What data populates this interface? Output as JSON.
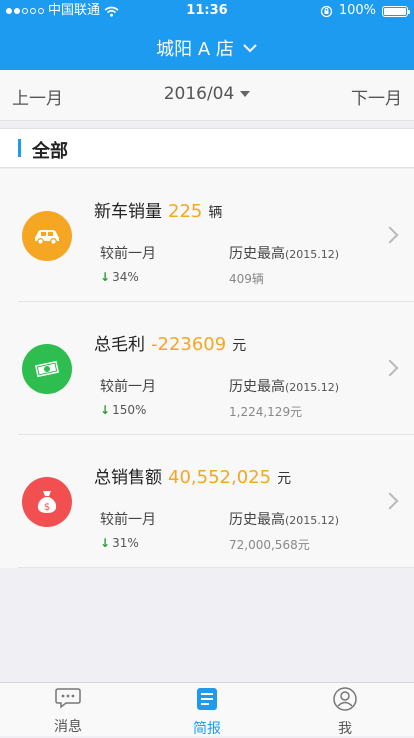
{
  "status": {
    "carrier": "中国联通",
    "time": "11:36",
    "battery": "100%"
  },
  "header": {
    "title": "城阳 A 店"
  },
  "month_nav": {
    "prev": "上一月",
    "current": "2016/04",
    "next": "下一月"
  },
  "section": {
    "title": "全部"
  },
  "cards": [
    {
      "name": "新车销量",
      "value": "225",
      "unit": "辆",
      "compare_label": "较前一月",
      "compare_value": "34%",
      "high_label": "历史最高",
      "high_period": "(2015.12)",
      "high_value": "409辆",
      "icon": "car-icon",
      "color": "#f5a623"
    },
    {
      "name": "总毛利",
      "value": "-223609",
      "unit": "元",
      "compare_label": "较前一月",
      "compare_value": "150%",
      "high_label": "历史最高",
      "high_period": "(2015.12)",
      "high_value": "1,224,129元",
      "icon": "money-icon",
      "color": "#2ebd4f"
    },
    {
      "name": "总销售额",
      "value": "40,552,025",
      "unit": "元",
      "compare_label": "较前一月",
      "compare_value": "31%",
      "high_label": "历史最高",
      "high_period": "(2015.12)",
      "high_value": "72,000,568元",
      "icon": "money-bag-icon",
      "color": "#f25050"
    }
  ],
  "tabs": [
    {
      "label": "消息",
      "icon": "message-icon"
    },
    {
      "label": "简报",
      "icon": "report-icon",
      "active": true
    },
    {
      "label": "我",
      "icon": "profile-icon"
    }
  ],
  "colors": {
    "primary": "#1c9bf0",
    "accent": "#f5a623",
    "down": "#2e9b38"
  }
}
